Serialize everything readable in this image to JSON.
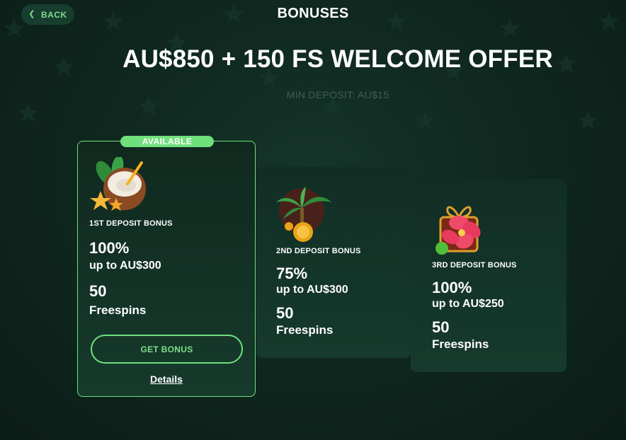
{
  "header": {
    "back_label": "BACK",
    "title": "BONUSES"
  },
  "offer": {
    "title": "AU$850 + 150 FS WELCOME OFFER",
    "min_deposit": "MIN DEPOSIT: AU$15"
  },
  "cards": [
    {
      "badge": "AVAILABLE",
      "icon": "coconut-icon",
      "name": "1ST DEPOSIT BONUS",
      "percent": "100%",
      "up_to": "up to AU$300",
      "freespins_count": "50",
      "freespins_label": "Freespins",
      "button_label": "GET BONUS",
      "details_label": "Details"
    },
    {
      "icon": "palm-coin-icon",
      "name": "2ND DEPOSIT BONUS",
      "percent": "75%",
      "up_to": "up to AU$300",
      "freespins_count": "50",
      "freespins_label": "Freespins"
    },
    {
      "icon": "flower-gift-icon",
      "name": "3RD DEPOSIT BONUS",
      "percent": "100%",
      "up_to": "up to AU$250",
      "freespins_count": "50",
      "freespins_label": "Freespins"
    }
  ],
  "colors": {
    "accent": "#6fe07c",
    "background": "#0d1f18",
    "card": "#163a2d"
  }
}
